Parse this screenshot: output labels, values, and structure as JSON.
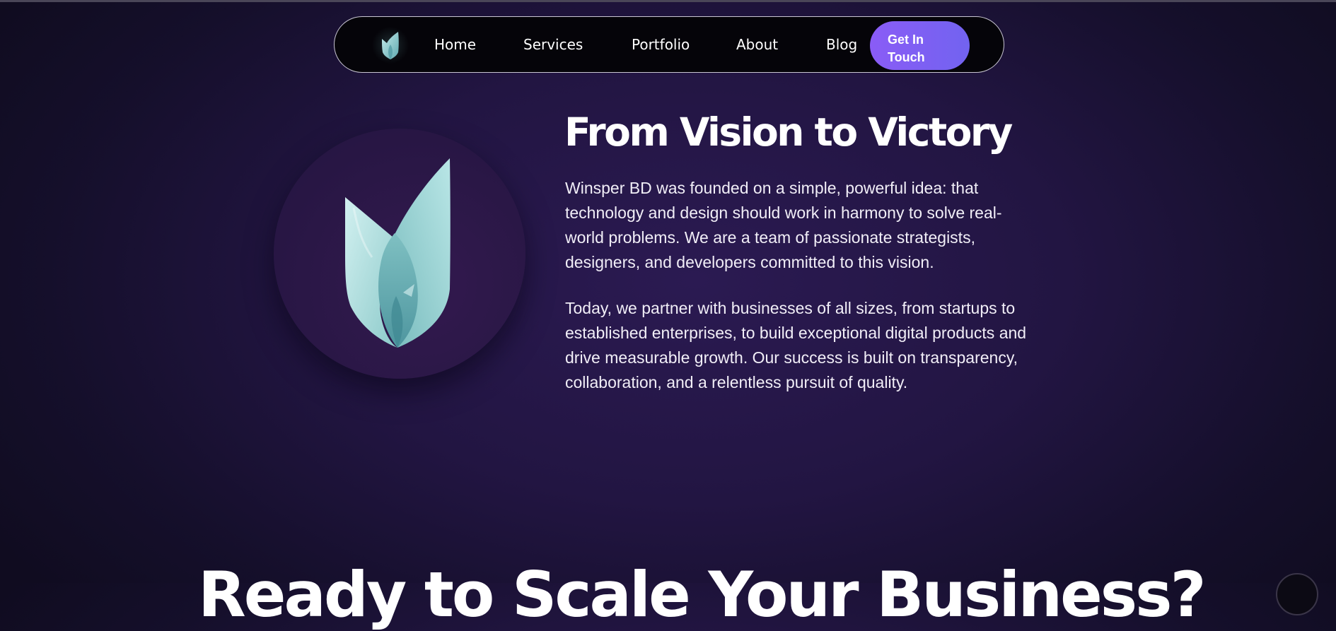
{
  "nav": {
    "logo_icon": "winsper-leaf-logo-icon",
    "links": [
      {
        "label": "Home"
      },
      {
        "label": "Services"
      },
      {
        "label": "Portfolio"
      },
      {
        "label": "About"
      },
      {
        "label": "Blog"
      }
    ],
    "cta_lines": [
      "Get In",
      "Touch"
    ]
  },
  "hero": {
    "logo_icon": "winsper-leaf-logo-icon",
    "title": "From Vision to Victory",
    "paragraph_1_lines": [
      "Winsper BD was founded on a simple, powerful idea: that",
      "technology and design should work in harmony to solve real-",
      "world problems. We are a team of passionate strategists,",
      "designers, and developers committed to this vision."
    ],
    "paragraph_2_lines": [
      "Today, we partner with businesses of all sizes, from startups to",
      "established enterprises, to build exceptional digital products and",
      "drive measurable growth. Our success is built on transparency,",
      "collaboration, and a relentless pursuit of quality."
    ]
  },
  "next_section": {
    "heading": "Ready to Scale Your Business?"
  },
  "colors": {
    "background": "#1f1438",
    "nav_background": "#050409",
    "cta_gradient_start": "#8a5cf6",
    "cta_gradient_end": "#7263f0",
    "logo_teal": "#8fd0d0"
  }
}
